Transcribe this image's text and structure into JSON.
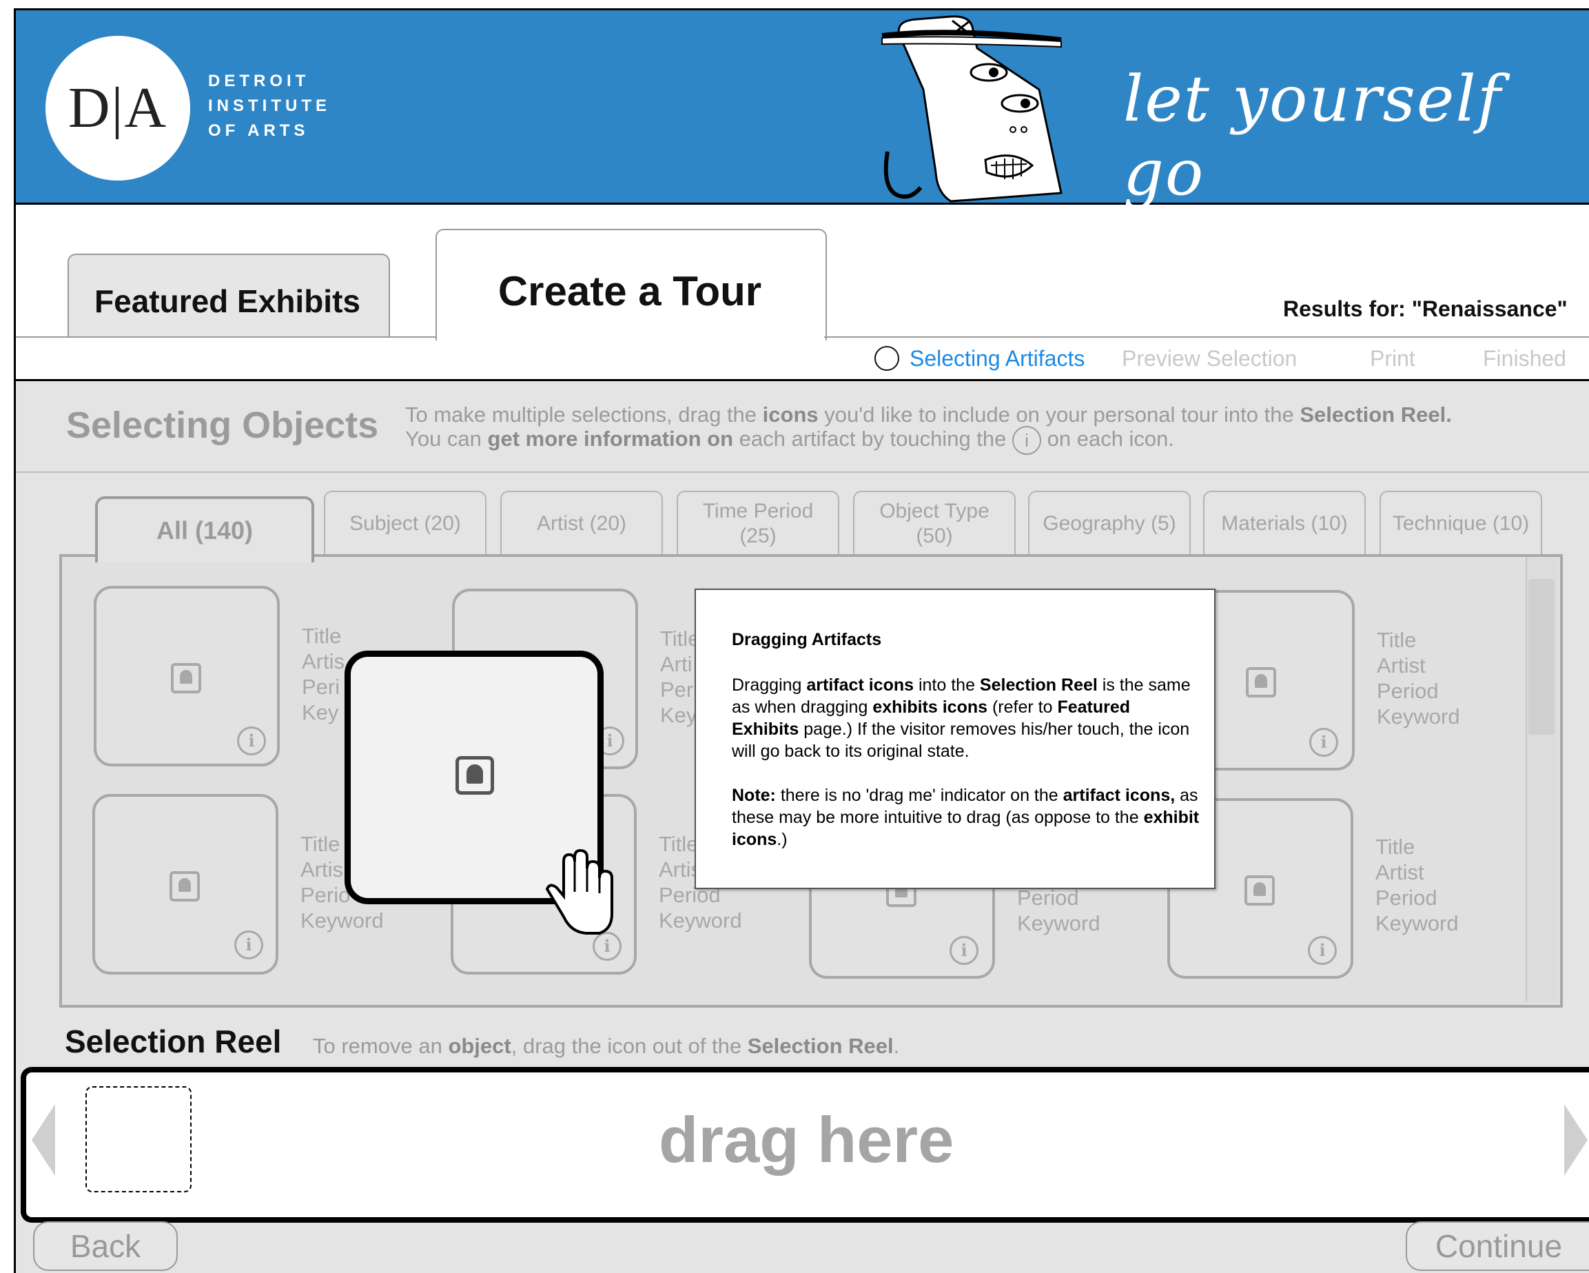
{
  "header": {
    "logo_letters": "D|A",
    "logo_lines": [
      "DETROIT",
      "INSTITUTE",
      "OF ARTS"
    ],
    "tagline": "let yourself go",
    "brand_color": "#2f86c6"
  },
  "tabs": {
    "featured": "Featured Exhibits",
    "create": "Create a Tour"
  },
  "results": "Results for: \"Renaissance\"",
  "steps": [
    "Selecting Artifacts",
    "Preview Selection",
    "Print",
    "Finished"
  ],
  "section": {
    "title": "Selecting Objects",
    "line1_a": "To make multiple selections, drag the ",
    "line1_b": "icons",
    "line1_c": " you'd like to include on your personal tour into the ",
    "line1_d": "Selection Reel.",
    "line2_a": "You can ",
    "line2_b": "get more information on",
    "line2_c": " each artifact by touching the ",
    "line2_d": " on each icon.",
    "info_glyph": "i"
  },
  "filters": {
    "all": "All  (140)",
    "subject": "Subject (20)",
    "artist": "Artist (20)",
    "time_period_1": "Time Period",
    "time_period_2": "(25)",
    "object_type_1": "Object Type",
    "object_type_2": "(50)",
    "geography": "Geography (5)",
    "materials": "Materials (10)",
    "technique": "Technique (10)"
  },
  "tile_meta": {
    "title": "Title",
    "artist": "Artist",
    "period": "Period",
    "keyword": "Keyword",
    "clip_title": "Title",
    "clip_artist": "Artis",
    "clip_artist_short": "Arti",
    "clip_period": "Peri",
    "clip_period_mid": "Per",
    "clip_keyword": "Key",
    "clip_period_b": "Perio",
    "clip_title_b": "Title"
  },
  "popup": {
    "title": "Dragging Artifacts",
    "p1_a": "Dragging ",
    "p1_b": "artifact icons",
    "p1_c": " into the ",
    "p1_d": "Selection Reel",
    "p1_e": " is the same as when dragging ",
    "p1_f": "exhibits icons",
    "p1_g": " (refer to ",
    "p1_h": "Featured Exhibits",
    "p1_i": " page.) If the visitor removes his/her touch, the icon will go back to its original state.",
    "p2_a": "Note:",
    "p2_b": " there is no 'drag me' indicator on the ",
    "p2_c": "artifact icons,",
    "p2_d": " as these may be more intuitive to drag (as oppose to the ",
    "p2_e": "exhibit icons",
    "p2_f": ".)"
  },
  "reel": {
    "title": "Selection Reel",
    "instr_a": "To remove an ",
    "instr_b": "object",
    "instr_c": ", drag the icon out of the ",
    "instr_d": "Selection Reel",
    "instr_e": ".",
    "placeholder": "drag here"
  },
  "buttons": {
    "back": "Back",
    "continue": "Continue"
  }
}
